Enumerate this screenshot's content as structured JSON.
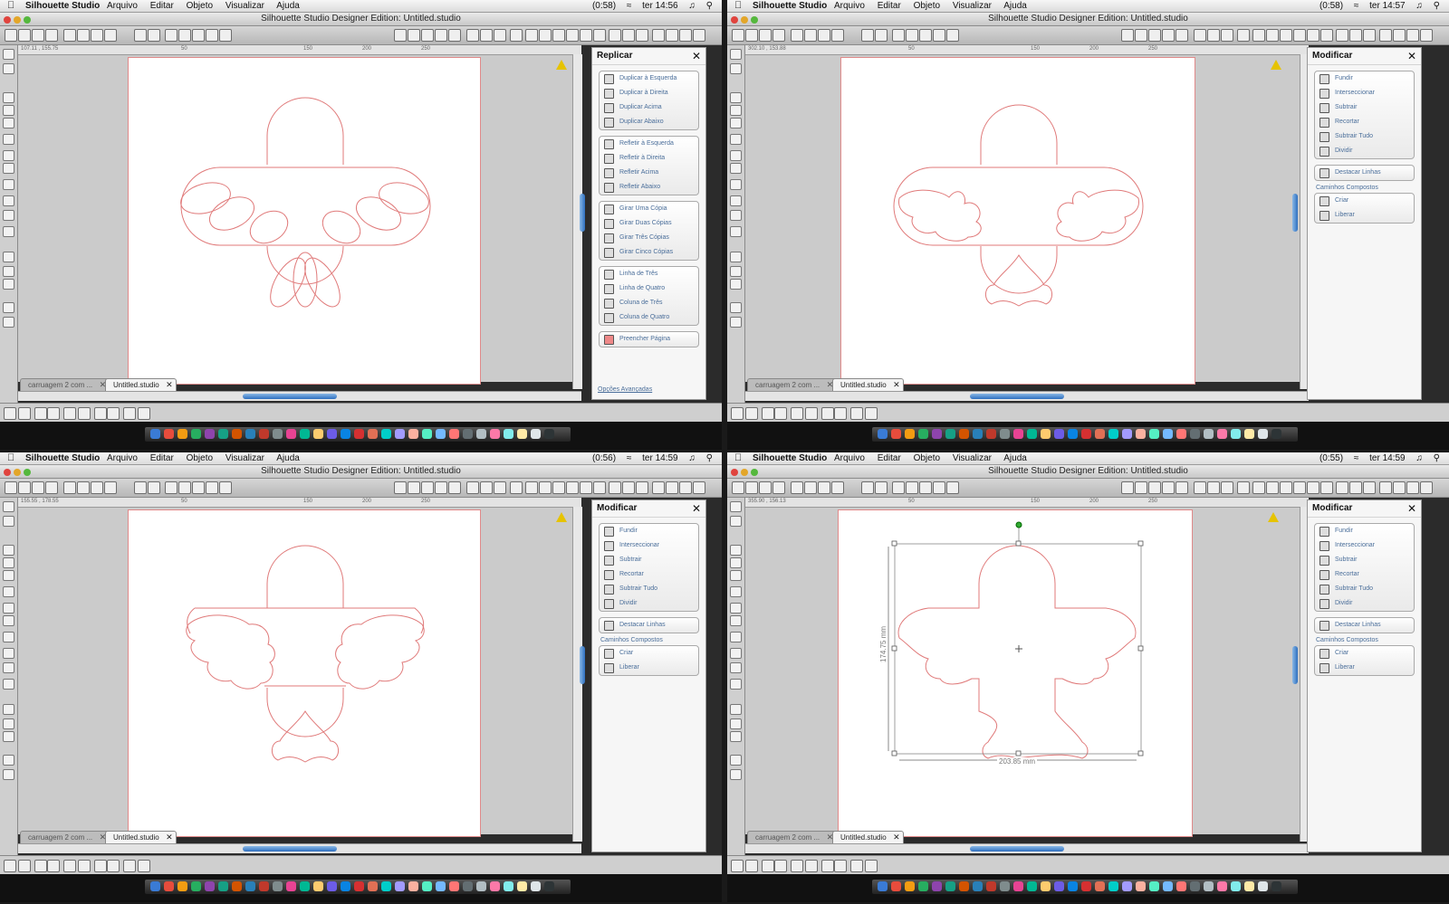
{
  "colors": {
    "shape": "#e07a7a",
    "panel_link": "#4a6e9a",
    "warning": "#e6c300",
    "scroll": "#2e6fbf"
  },
  "menubar": {
    "app": "Silhouette Studio",
    "menus": [
      "Arquivo",
      "Editar",
      "Objeto",
      "Visualizar",
      "Ajuda"
    ]
  },
  "window_title": "Silhouette Studio Designer Edition: Untitled.studio",
  "tabs": [
    "carruagem 2 com ...",
    "Untitled.studio"
  ],
  "quadrants": [
    {
      "battery": "(0:58)",
      "clock": "ter 14:56",
      "ruler_coords": "107.11 , 155.75",
      "panel": {
        "title": "Replicar",
        "groups": [
          {
            "items": [
              "Duplicar à Esquerda",
              "Duplicar à Direita",
              "Duplicar Acima",
              "Duplicar Abaixo"
            ]
          },
          {
            "items": [
              "Refletir à Esquerda",
              "Refletir à Direita",
              "Refletir Acima",
              "Refletir Abaixo"
            ]
          },
          {
            "items": [
              "Girar Uma Cópia",
              "Girar Duas Cópias",
              "Girar Três Cópias",
              "Girar Cinco Cópias"
            ]
          },
          {
            "items": [
              "Linha de Três",
              "Linha de Quatro",
              "Coluna de Três",
              "Coluna de Quatro"
            ]
          },
          {
            "items": [
              "Preencher Página"
            ]
          }
        ],
        "footer_link": "Opções Avançadas"
      }
    },
    {
      "battery": "(0:58)",
      "clock": "ter 14:57",
      "ruler_coords": "302.10 , 153.88",
      "panel": {
        "title": "Modificar",
        "groups": [
          {
            "items": [
              "Fundir",
              "Interseccionar",
              "Subtrair",
              "Recortar",
              "Subtrair Tudo",
              "Dividir"
            ]
          },
          {
            "items": [
              "Destacar Linhas"
            ]
          }
        ],
        "subheading": "Caminhos Compostos",
        "compound": {
          "items": [
            "Criar",
            "Liberar"
          ]
        }
      }
    },
    {
      "battery": "(0:56)",
      "clock": "ter 14:59",
      "ruler_coords": "155.55 , 178.55",
      "panel": {
        "title": "Modificar",
        "groups": [
          {
            "items": [
              "Fundir",
              "Interseccionar",
              "Subtrair",
              "Recortar",
              "Subtrair Tudo",
              "Dividir"
            ]
          },
          {
            "items": [
              "Destacar Linhas"
            ]
          }
        ],
        "subheading": "Caminhos Compostos",
        "compound": {
          "items": [
            "Criar",
            "Liberar"
          ]
        }
      }
    },
    {
      "battery": "(0:55)",
      "clock": "ter 14:59",
      "ruler_coords": "355.90 , 156.13",
      "panel": {
        "title": "Modificar",
        "groups": [
          {
            "items": [
              "Fundir",
              "Interseccionar",
              "Subtrair",
              "Recortar",
              "Subtrair Tudo",
              "Dividir"
            ]
          },
          {
            "items": [
              "Destacar Linhas"
            ]
          }
        ],
        "subheading": "Caminhos Compostos",
        "compound": {
          "items": [
            "Criar",
            "Liberar"
          ]
        }
      },
      "dimensions": {
        "height": "174.75 mm",
        "width": "203.85 mm"
      }
    }
  ],
  "ruler_ticks": [
    "50",
    "150",
    "200",
    "250"
  ]
}
